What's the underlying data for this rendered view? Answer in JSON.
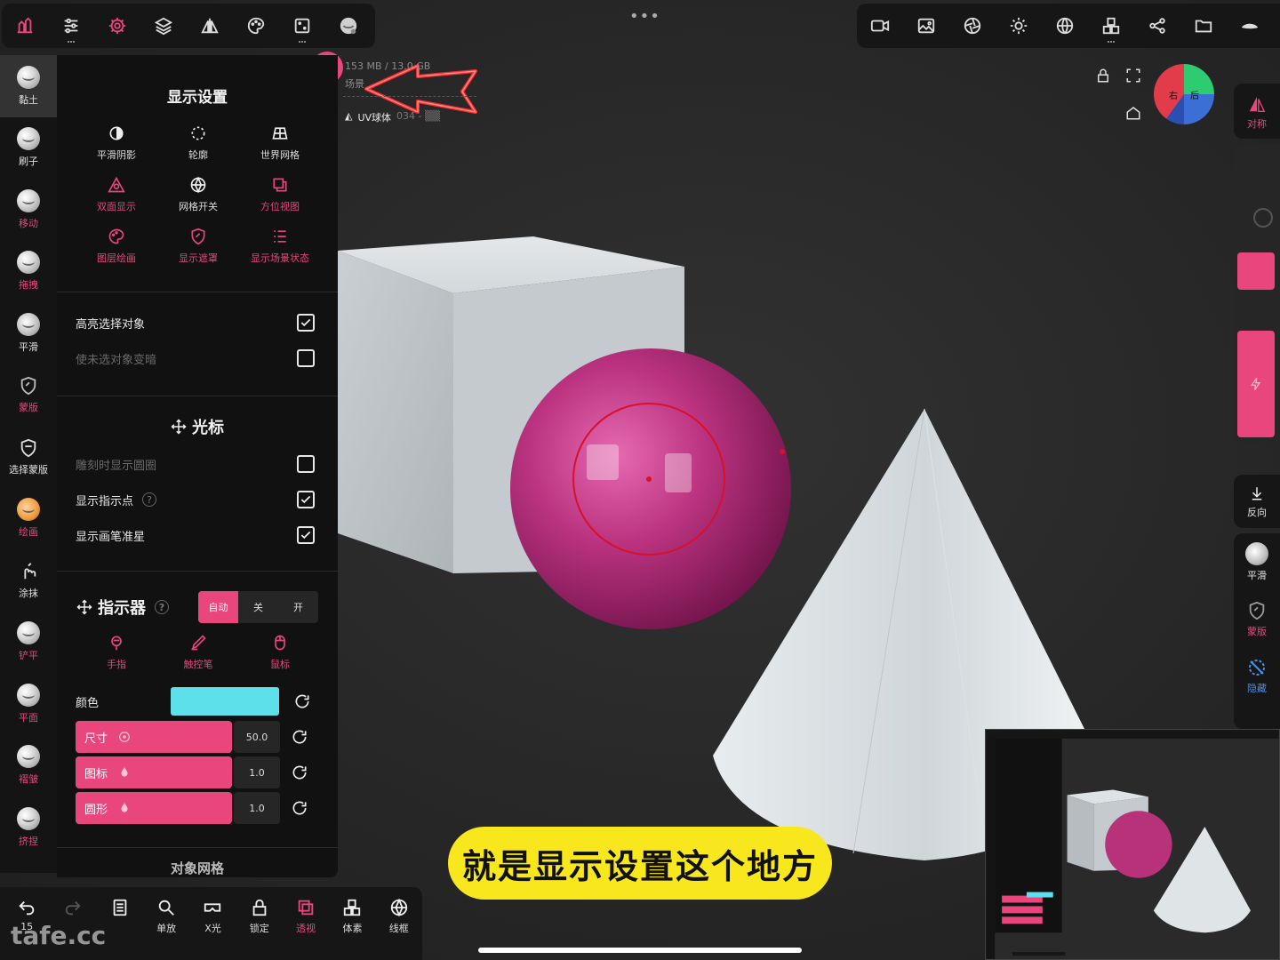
{
  "top_toolbar_left": {
    "icons": [
      "tools-icon",
      "sliders-icon",
      "gear-icon",
      "layers-icon",
      "symmetry-icon",
      "palette-icon",
      "dice-icon",
      "matcap-icon"
    ]
  },
  "top_toolbar_right": {
    "icons": [
      "video-icon",
      "image-icon",
      "aperture-icon",
      "sun-icon",
      "sphere-grid-icon",
      "cubes-icon",
      "share-icon",
      "folder-icon",
      "eye-icon"
    ]
  },
  "scene_info": {
    "memory": "153 MB / 13.0 GB",
    "scene_label": "场景",
    "object_name": "UV球体",
    "object_suffix": "034 - ▒▒"
  },
  "gizmo": {
    "face_left": "右",
    "face_right": "后"
  },
  "left_tools": [
    {
      "label": "黏土",
      "selected": true
    },
    {
      "label": "刷子"
    },
    {
      "label": "移动",
      "pink": true
    },
    {
      "label": "拖拽",
      "pink": true
    },
    {
      "label": "平滑"
    },
    {
      "label": "蒙版",
      "pink": true,
      "icon": "mask-shield-icon"
    },
    {
      "label": "选择蒙版",
      "icon": "select-mask-icon"
    },
    {
      "label": "绘画",
      "pink": true
    },
    {
      "label": "涂抹",
      "icon": "smudge-icon"
    },
    {
      "label": "铲平",
      "pink": true
    },
    {
      "label": "平面",
      "pink": true
    },
    {
      "label": "褶皱",
      "pink": true
    },
    {
      "label": "挤捏",
      "pink": true
    }
  ],
  "panel": {
    "title": "显示设置",
    "icons": [
      {
        "label": "平滑阴影",
        "icon": "smooth-shading-icon",
        "pink": false
      },
      {
        "label": "轮廓",
        "icon": "outline-icon",
        "pink": false
      },
      {
        "label": "世界网格",
        "icon": "world-grid-icon",
        "pink": false
      },
      {
        "label": "双面显示",
        "icon": "double-side-icon",
        "pink": true
      },
      {
        "label": "网格开关",
        "icon": "wireframe-icon",
        "pink": false
      },
      {
        "label": "方位视图",
        "icon": "orientation-view-icon",
        "pink": true
      },
      {
        "label": "图层绘画",
        "icon": "layer-paint-icon",
        "pink": true
      },
      {
        "label": "显示遮罩",
        "icon": "show-mask-icon",
        "pink": true
      },
      {
        "label": "显示场景状态",
        "icon": "scene-state-icon",
        "pink": true
      }
    ],
    "highlight_selected": {
      "label": "高亮选择对象",
      "checked": true
    },
    "darken_unselected": {
      "label": "使未选对象变暗",
      "checked": false
    },
    "cursor_title": "光标",
    "cursor_circle": {
      "label": "雕刻时显示圆圈",
      "checked": false
    },
    "show_pointer": {
      "label": "显示指示点",
      "checked": true
    },
    "show_crosshair": {
      "label": "显示画笔准星",
      "checked": true
    },
    "indicator_title": "指示器",
    "indicator_modes": [
      "自动",
      "关",
      "开"
    ],
    "indicator_active": "自动",
    "indicator_devices": [
      {
        "label": "手指",
        "icon": "finger-icon"
      },
      {
        "label": "触控笔",
        "icon": "stylus-icon"
      },
      {
        "label": "鼠标",
        "icon": "mouse-icon"
      }
    ],
    "color_label": "颜色",
    "color_value": "#5ee0ea",
    "sliders": [
      {
        "label": "尺寸",
        "value": "50.0"
      },
      {
        "label": "图标",
        "value": "1.0"
      },
      {
        "label": "圆形",
        "value": "1.0"
      }
    ],
    "next_section": "对象网格"
  },
  "right_tools": {
    "symmetry": "对称",
    "reverse": "反向",
    "smooth": "平滑",
    "mask": "蒙版",
    "hide": "隐藏"
  },
  "bottom_bar": [
    {
      "label": "15",
      "icon": "undo-icon"
    },
    {
      "label": "",
      "icon": "redo-icon"
    },
    {
      "label": "",
      "icon": "book-icon"
    },
    {
      "label": "单放",
      "icon": "zoom-icon"
    },
    {
      "label": "X光",
      "icon": "xray-icon"
    },
    {
      "label": "锁定",
      "icon": "lock-icon"
    },
    {
      "label": "透视",
      "icon": "perspective-icon",
      "pink": true
    },
    {
      "label": "体素",
      "icon": "voxel-icon"
    },
    {
      "label": "线框",
      "icon": "wire-icon"
    }
  ],
  "subtitle": "就是显示设置这个地方",
  "watermark": "tafe.cc",
  "colors": {
    "accent": "#e8467c",
    "panel_bg": "#111111",
    "sphere": "#b8327a",
    "subtitle_bg": "#f8e71c"
  }
}
